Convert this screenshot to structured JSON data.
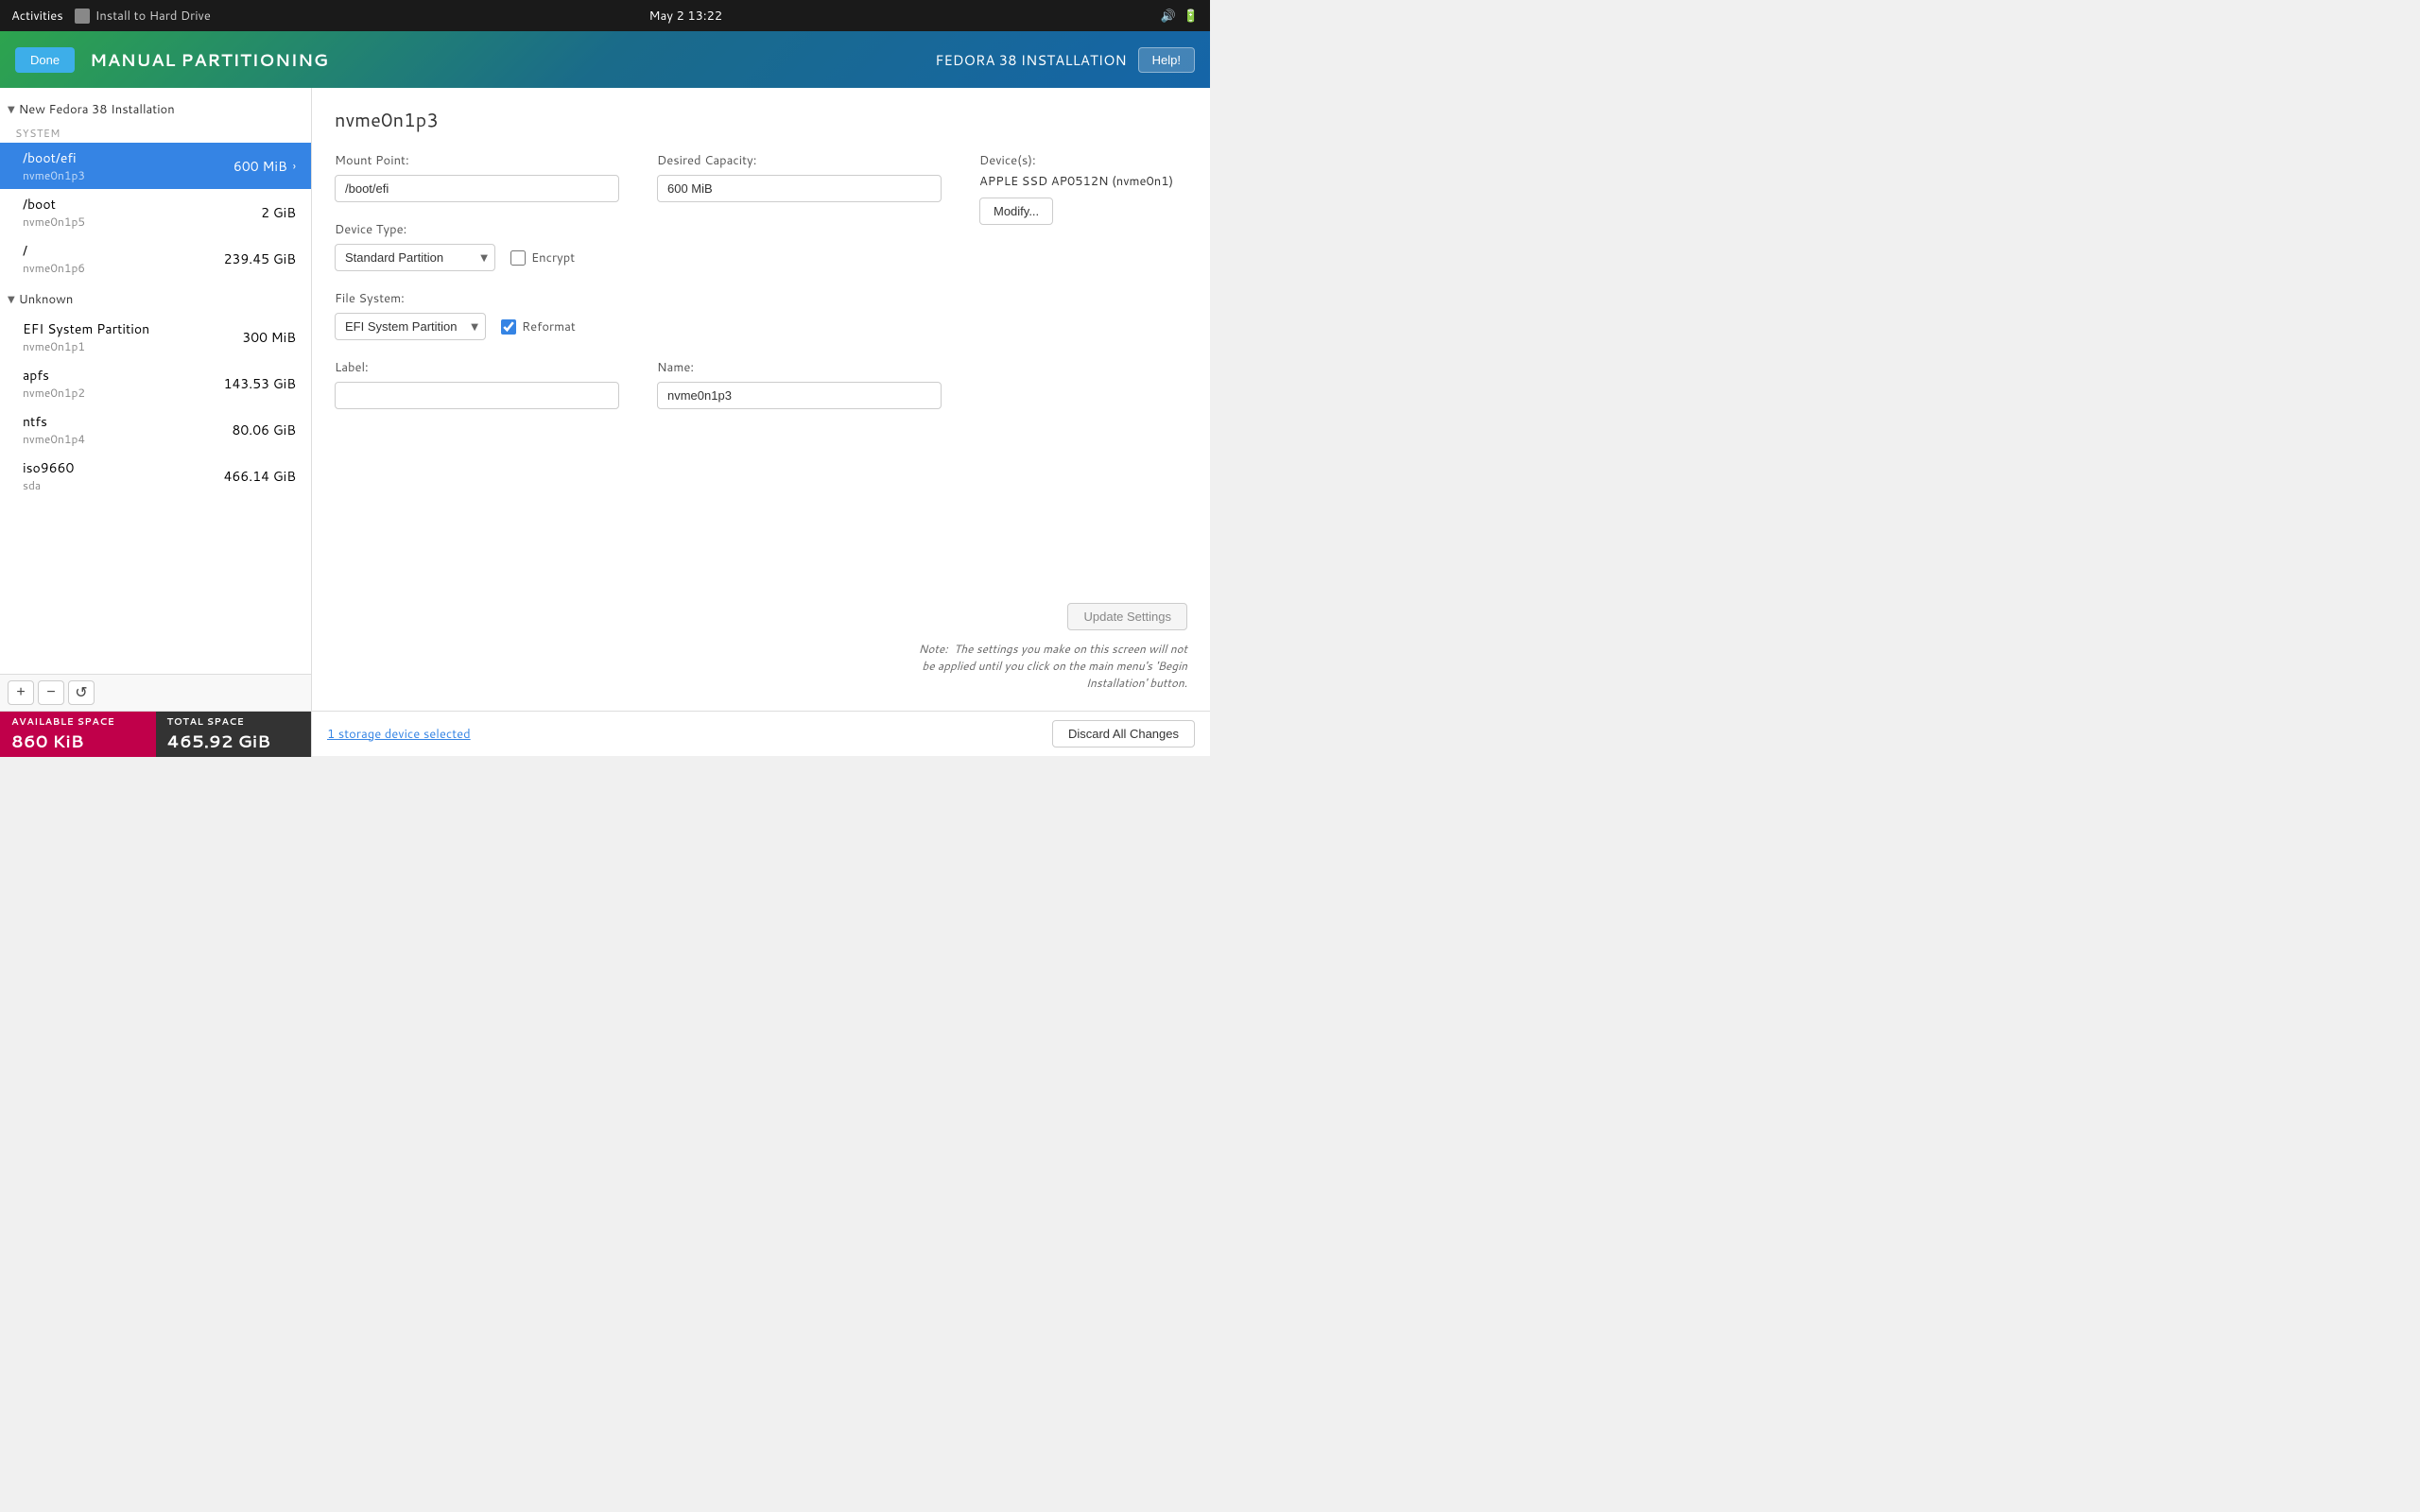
{
  "topbar": {
    "activities": "Activities",
    "app_title": "Install to Hard Drive",
    "datetime": "May 2  13:22"
  },
  "header": {
    "title": "MANUAL PARTITIONING",
    "done_label": "Done",
    "fedora_label": "FEDORA 38 INSTALLATION",
    "help_label": "Help!"
  },
  "partition_list": {
    "section_new": "New Fedora 38 Installation",
    "section_system": "SYSTEM",
    "section_unknown": "Unknown",
    "system_items": [
      {
        "name": "/boot/efi",
        "device": "nvme0n1p3",
        "size": "600 MiB",
        "selected": true
      },
      {
        "name": "/boot",
        "device": "nvme0n1p5",
        "size": "2 GiB",
        "selected": false
      },
      {
        "name": "/",
        "device": "nvme0n1p6",
        "size": "239.45 GiB",
        "selected": false
      }
    ],
    "unknown_items": [
      {
        "name": "EFI System Partition",
        "device": "nvme0n1p1",
        "size": "300 MiB"
      },
      {
        "name": "apfs",
        "device": "nvme0n1p2",
        "size": "143.53 GiB"
      },
      {
        "name": "ntfs",
        "device": "nvme0n1p4",
        "size": "80.06 GiB"
      },
      {
        "name": "iso9660",
        "device": "sda",
        "size": "466.14 GiB"
      }
    ]
  },
  "toolbar": {
    "add": "+",
    "remove": "−",
    "refresh": "↺"
  },
  "space": {
    "available_label": "AVAILABLE SPACE",
    "available_value": "860 KiB",
    "total_label": "TOTAL SPACE",
    "total_value": "465.92 GiB"
  },
  "detail": {
    "partition_title": "nvme0n1p3",
    "mount_point_label": "Mount Point:",
    "mount_point_value": "/boot/efi",
    "desired_capacity_label": "Desired Capacity:",
    "desired_capacity_value": "600 MiB",
    "device_type_label": "Device Type:",
    "device_type_value": "Standard Partition",
    "encrypt_label": "Encrypt",
    "filesystem_label": "File System:",
    "filesystem_value": "EFI System Partition",
    "reformat_label": "Reformat",
    "devices_label": "Device(s):",
    "devices_value": "APPLE SSD AP0512N (nvme0n1)",
    "modify_label": "Modify...",
    "label_label": "Label:",
    "label_value": "",
    "name_label": "Name:",
    "name_value": "nvme0n1p3",
    "update_settings_label": "Update Settings",
    "note_text": "Note:  The settings you make on this screen will not\nbe applied until you click on the main menu's 'Begin\nInstallation' button."
  },
  "bottom": {
    "storage_link": "1 storage device selected",
    "discard_label": "Discard All Changes"
  }
}
